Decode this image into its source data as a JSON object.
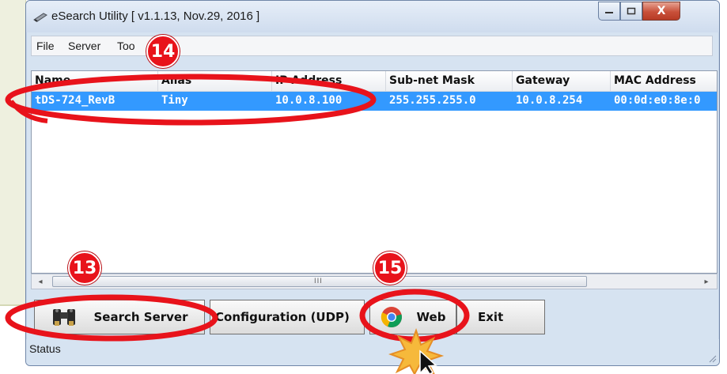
{
  "window": {
    "title": "eSearch Utility [ v1.1.13, Nov.29, 2016 ]",
    "minimize_label": "",
    "maximize_label": "",
    "close_label": "X"
  },
  "menu": {
    "items": [
      {
        "label": "File"
      },
      {
        "label": "Server"
      },
      {
        "label": "Too"
      }
    ]
  },
  "table": {
    "columns": [
      "Name",
      "Alias",
      "IP Address",
      "Sub-net Mask",
      "Gateway",
      "MAC Address"
    ],
    "rows": [
      {
        "selected": true,
        "cells": [
          "tDS-724_RevB",
          "Tiny",
          "10.0.8.100",
          "255.255.255.0",
          "10.0.8.254",
          "00:0d:e0:8e:0"
        ]
      }
    ]
  },
  "scrollbar": {
    "left_arrow": "◂",
    "right_arrow": "▸",
    "grip": "III"
  },
  "buttons": {
    "search": "Search Server",
    "config": "Configuration (UDP)",
    "web": "Web",
    "exit": "Exit"
  },
  "status": {
    "text": "Status"
  },
  "callouts": [
    {
      "number": "14"
    },
    {
      "number": "13"
    },
    {
      "number": "15"
    }
  ],
  "colors": {
    "selection": "#3399ff",
    "callout_red": "#e8131b",
    "window_frame": "#d6e3f1"
  },
  "icons": {
    "app": "esearch-app-icon",
    "search": "binoculars-icon",
    "web": "chrome-icon",
    "cursor": "mouse-pointer-icon",
    "click": "click-burst-icon"
  }
}
